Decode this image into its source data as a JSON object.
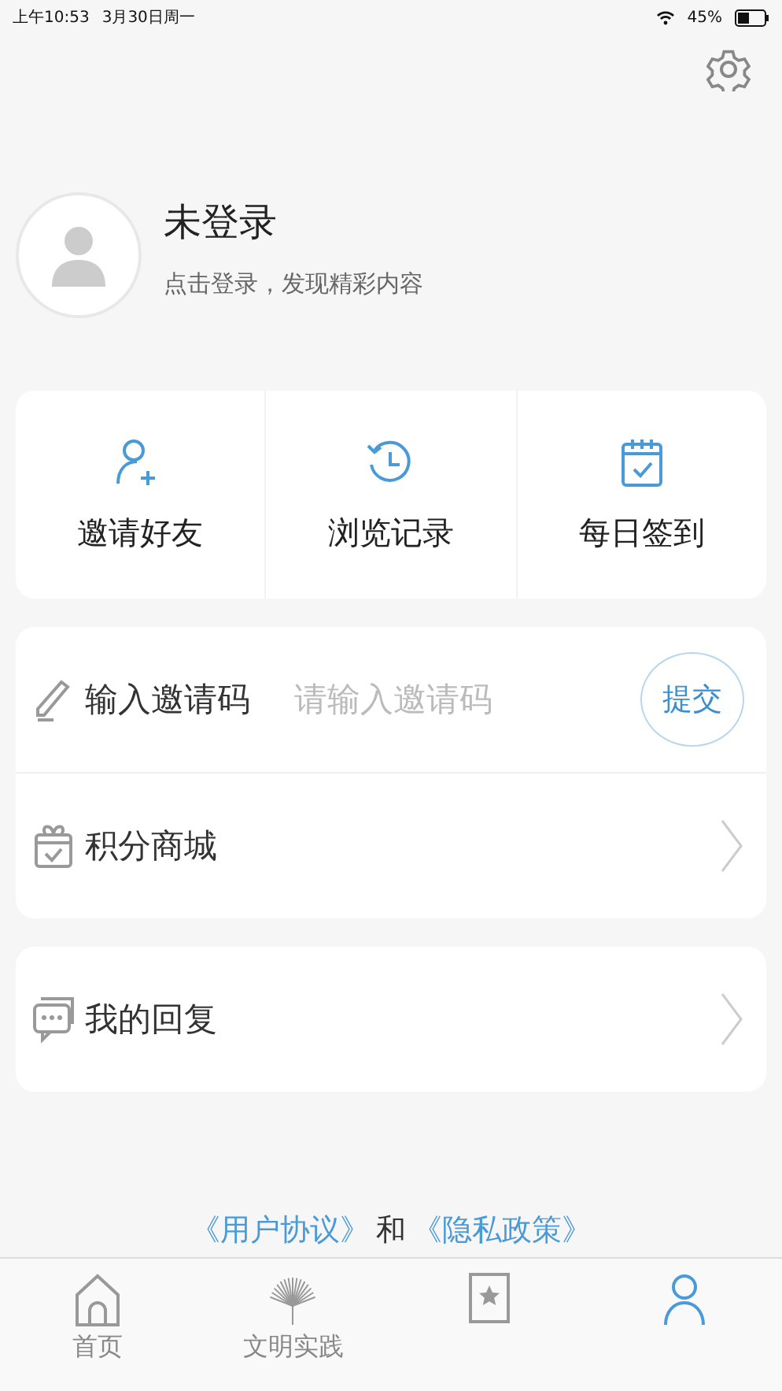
{
  "status_bar": {
    "time": "上午10:53",
    "date": "3月30日周一",
    "battery": "45%"
  },
  "profile": {
    "name": "未登录",
    "subtitle": "点击登录，发现精彩内容"
  },
  "quick_actions": [
    {
      "label": "邀请好友",
      "kind": "invite"
    },
    {
      "label": "浏览记录",
      "kind": "history"
    },
    {
      "label": "每日签到",
      "kind": "checkin"
    }
  ],
  "invite_code": {
    "label": "输入邀请码",
    "placeholder": "请输入邀请码",
    "button": "提交"
  },
  "menu_groups": [
    [
      {
        "label": "积分商城",
        "kind": "mall"
      }
    ],
    [
      {
        "label": "我的回复",
        "kind": "reply"
      }
    ]
  ],
  "agreement": {
    "links": [
      "《用户协议》",
      "《隐私政策》"
    ],
    "joiner": "和"
  },
  "tabs": [
    {
      "label": "首页",
      "kind": "home",
      "selected": false
    },
    {
      "label": "文明实践",
      "kind": "practice",
      "selected": false
    },
    {
      "kind": "favorite",
      "selected": false
    },
    {
      "kind": "profile",
      "selected": true
    }
  ]
}
